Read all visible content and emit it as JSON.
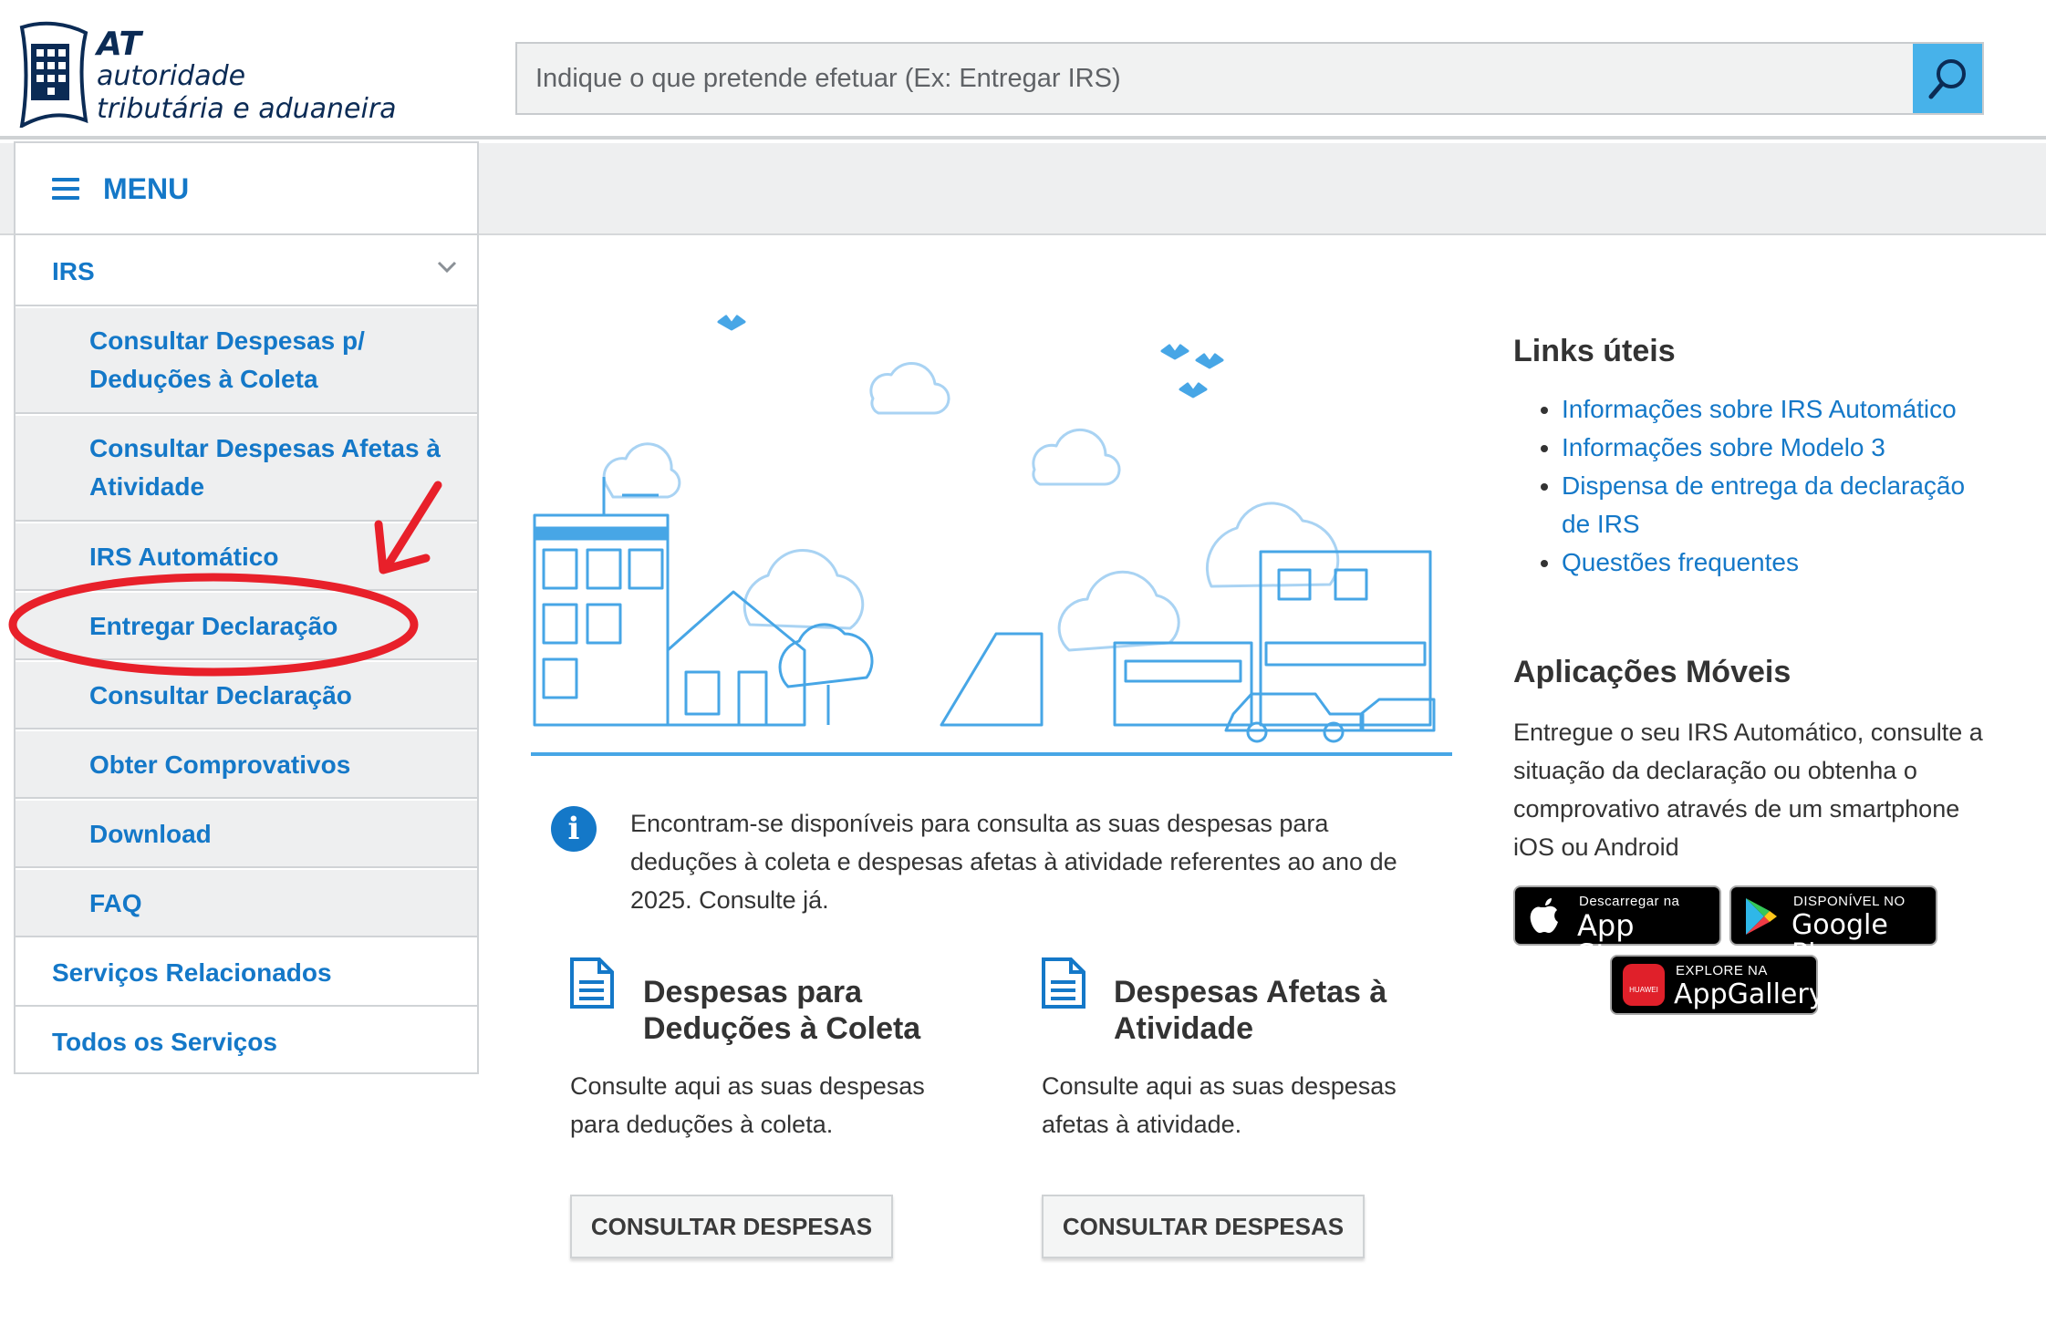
{
  "header": {
    "logo": {
      "abbr": "AT",
      "line1": "autoridade",
      "line2": "tributária e aduaneira"
    },
    "search": {
      "placeholder": "Indique o que pretende efetuar (Ex: Entregar IRS)",
      "button_icon": "search-icon"
    }
  },
  "sidebar": {
    "menu_label": "MENU",
    "menu_icon": "hamburger-icon",
    "section": "IRS",
    "section_icon": "chevron-down-icon",
    "sub_items": [
      "Consultar Despesas p/ Deduções à Coleta",
      "Consultar Despesas Afetas à Atividade",
      "IRS Automático",
      "Entregar Declaração",
      "Consultar Declaração",
      "Obter Comprovativos",
      "Download",
      "FAQ"
    ],
    "bottom_items": [
      "Serviços Relacionados",
      "Todos os Serviços"
    ]
  },
  "main": {
    "info_icon": "info-icon",
    "info_text": "Encontram-se disponíveis para consulta as suas despesas para deduções à coleta e despesas afetas à atividade referentes ao ano de 2025. Consulte já.",
    "cards": [
      {
        "icon": "document-icon",
        "title": "Despesas para Deduções à Coleta",
        "desc": "Consulte aqui as suas despesas para deduções à coleta.",
        "button": "CONSULTAR DESPESAS"
      },
      {
        "icon": "document-icon",
        "title": "Despesas Afetas à Atividade",
        "desc": "Consulte aqui as suas despesas afetas à atividade.",
        "button": "CONSULTAR DESPESAS"
      }
    ]
  },
  "right": {
    "links_title": "Links úteis",
    "links": [
      "Informações sobre IRS Automático",
      "Informações sobre Modelo 3",
      "Dispensa de entrega da declaração de IRS",
      "Questões frequentes"
    ],
    "apps_title": "Aplicações Móveis",
    "apps_text": "Entregue o seu IRS Automático, consulte a situação da declaração ou obtenha o comprovativo através de um smartphone iOS ou Android",
    "badges": {
      "appstore": {
        "small": "Descarregar na",
        "big": "App Store",
        "icon": "apple-icon"
      },
      "googleplay": {
        "small": "DISPONÍVEL NO",
        "big": "Google Play",
        "icon": "google-play-icon"
      },
      "appgallery": {
        "small": "EXPLORE NA",
        "big": "AppGallery",
        "brand": "HUAWEI",
        "icon": "huawei-icon"
      }
    }
  },
  "colors": {
    "link_blue": "#1478c8",
    "search_button": "#47b2ea",
    "annotation_red": "#e8202a"
  }
}
